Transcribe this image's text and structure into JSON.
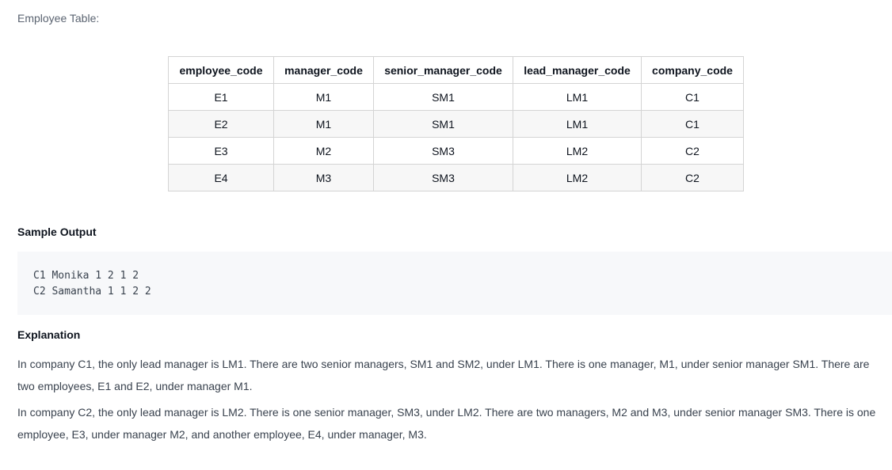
{
  "employee_table": {
    "caption": "Employee Table:",
    "columns": [
      "employee_code",
      "manager_code",
      "senior_manager_code",
      "lead_manager_code",
      "company_code"
    ],
    "rows": [
      [
        "E1",
        "M1",
        "SM1",
        "LM1",
        "C1"
      ],
      [
        "E2",
        "M1",
        "SM1",
        "LM1",
        "C1"
      ],
      [
        "E3",
        "M2",
        "SM3",
        "LM2",
        "C2"
      ],
      [
        "E4",
        "M3",
        "SM3",
        "LM2",
        "C2"
      ]
    ]
  },
  "sample_output": {
    "heading": "Sample Output",
    "lines": [
      "C1 Monika 1 2 1 2",
      "C2 Samantha 1 1 2 2"
    ]
  },
  "explanation": {
    "heading": "Explanation",
    "paragraphs": [
      "In company C1, the only lead manager is LM1. There are two senior managers, SM1 and SM2, under LM1. There is one manager, M1, under senior manager SM1. There are two employees, E1 and E2, under manager M1.",
      "In company C2, the only lead manager is LM2. There is one senior manager, SM3, under LM2. There are two managers, M2 and M3, under senior manager SM3. There is one employee, E3, under manager M2, and another employee, E4, under manager, M3."
    ]
  }
}
